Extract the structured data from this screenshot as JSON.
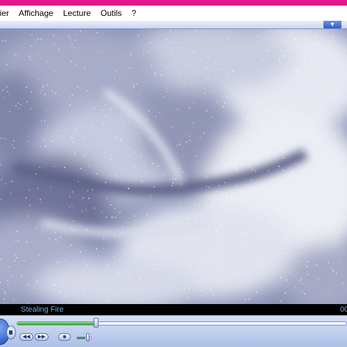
{
  "window": {
    "title_color": "#e0168c"
  },
  "menu": {
    "items": [
      {
        "label": "hier"
      },
      {
        "label": "Affichage"
      },
      {
        "label": "Lecture"
      },
      {
        "label": "Outils"
      },
      {
        "label": "?"
      }
    ]
  },
  "video": {
    "frame_icon": "cloud-video-frame"
  },
  "now_playing": {
    "title": "Stealing Fire",
    "time": "00"
  },
  "playback": {
    "seek_fraction": 0.24,
    "volume_fraction": 0.6
  },
  "controls": {
    "play_icon": "play-icon",
    "stop_icon": "stop-icon",
    "prev_icon": "previous-icon",
    "next_icon": "next-icon",
    "mute_icon": "mute-icon"
  },
  "colors": {
    "accent": "#2f5bd0",
    "progress": "#2f9a2c",
    "info_text": "#7ea8e6"
  }
}
